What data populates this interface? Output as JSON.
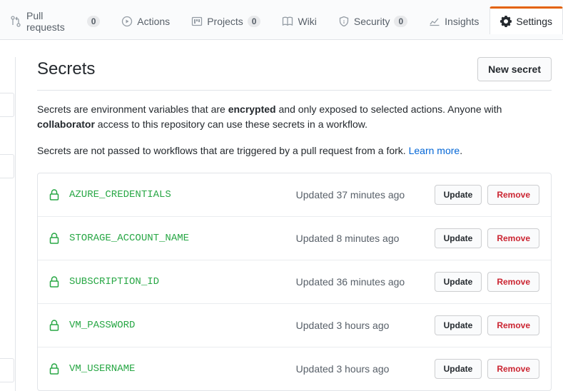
{
  "tabs": {
    "pull_requests": {
      "label": "Pull requests",
      "count": "0"
    },
    "actions": {
      "label": "Actions"
    },
    "projects": {
      "label": "Projects",
      "count": "0"
    },
    "wiki": {
      "label": "Wiki"
    },
    "security": {
      "label": "Security",
      "count": "0"
    },
    "insights": {
      "label": "Insights"
    },
    "settings": {
      "label": "Settings"
    }
  },
  "page": {
    "heading": "Secrets",
    "new_button": "New secret",
    "desc_pre": "Secrets are environment variables that are ",
    "desc_enc": "encrypted",
    "desc_mid": " and only exposed to selected actions. Anyone with ",
    "desc_collab": "collaborator",
    "desc_post": " access to this repository can use these secrets in a workflow.",
    "desc2_pre": "Secrets are not passed to workflows that are triggered by a pull request from a fork. ",
    "learn_more": "Learn more",
    "period": "."
  },
  "actions": {
    "update": "Update",
    "remove": "Remove"
  },
  "secrets": [
    {
      "name": "AZURE_CREDENTIALS",
      "updated": "Updated 37 minutes ago"
    },
    {
      "name": "STORAGE_ACCOUNT_NAME",
      "updated": "Updated 8 minutes ago"
    },
    {
      "name": "SUBSCRIPTION_ID",
      "updated": "Updated 36 minutes ago"
    },
    {
      "name": "VM_PASSWORD",
      "updated": "Updated 3 hours ago"
    },
    {
      "name": "VM_USERNAME",
      "updated": "Updated 3 hours ago"
    }
  ]
}
